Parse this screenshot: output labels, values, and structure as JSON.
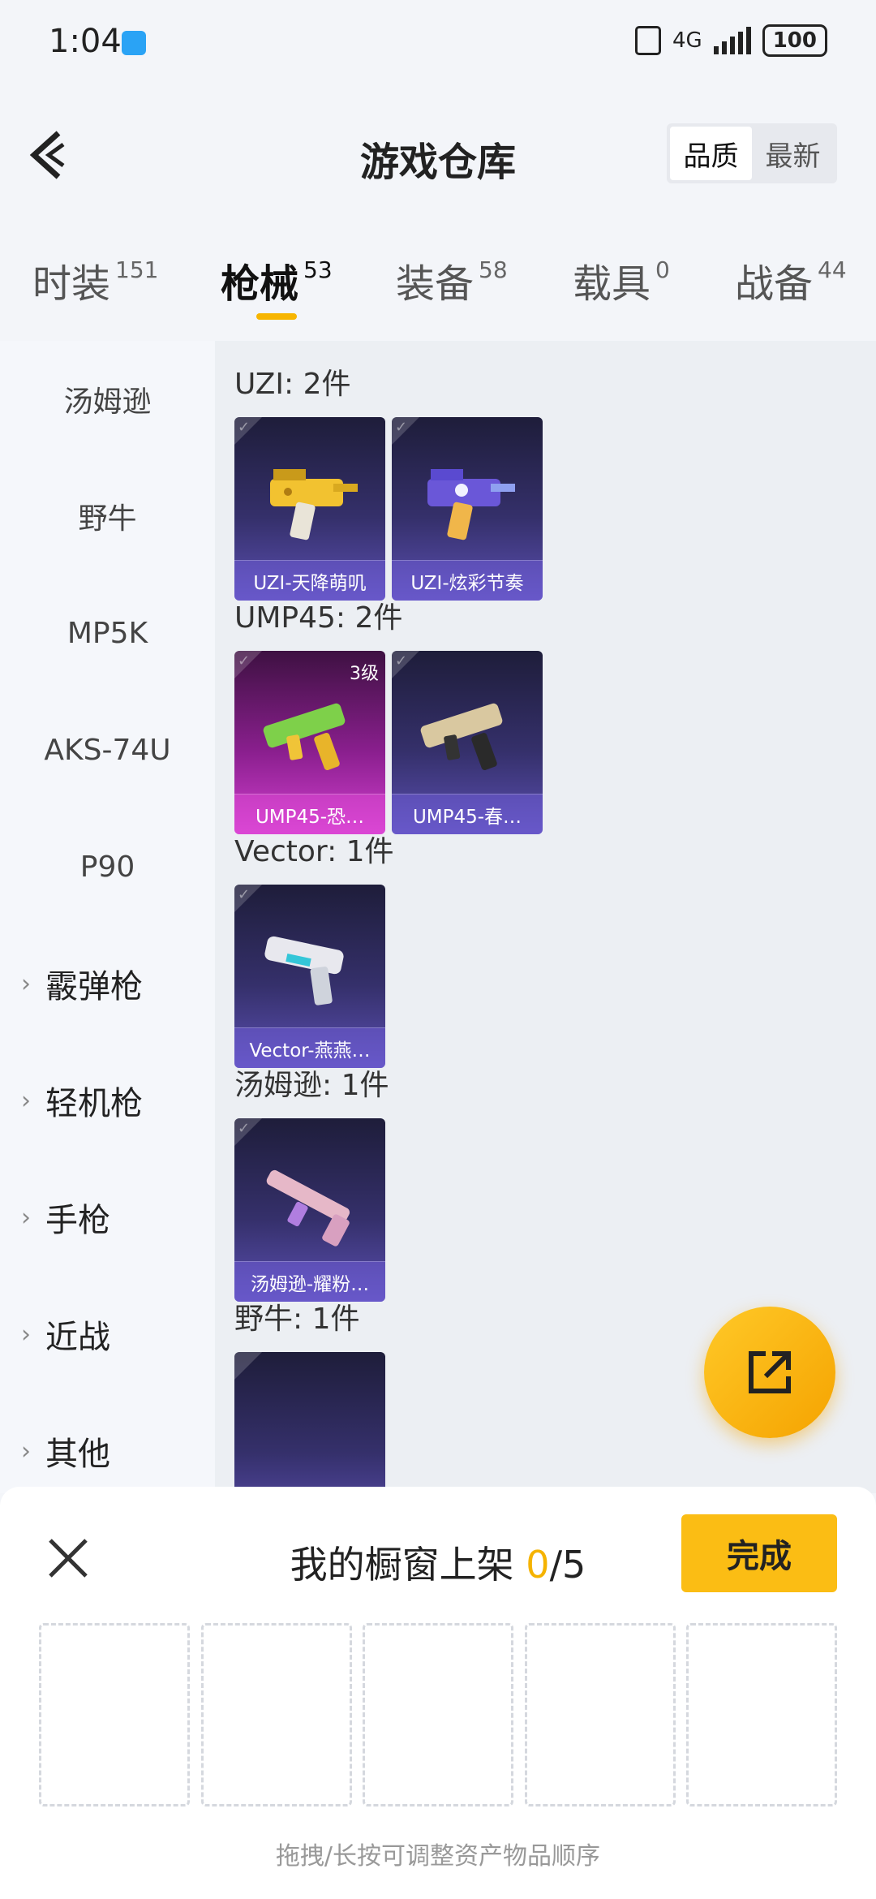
{
  "status_bar": {
    "time": "1:04",
    "network": "4G",
    "battery": "100"
  },
  "header": {
    "title": "游戏仓库",
    "sort_options": [
      "品质",
      "最新"
    ],
    "active_sort": "品质"
  },
  "tabs": [
    {
      "label": "时装",
      "count": "151"
    },
    {
      "label": "枪械",
      "count": "53"
    },
    {
      "label": "装备",
      "count": "58"
    },
    {
      "label": "载具",
      "count": "0"
    },
    {
      "label": "战备",
      "count": "44"
    }
  ],
  "active_tab": "枪械",
  "sidebar": {
    "items": [
      "汤姆逊",
      "野牛",
      "MP5K",
      "AKS-74U",
      "P90"
    ],
    "groups": [
      "霰弹枪",
      "轻机枪",
      "手枪",
      "近战",
      "其他"
    ]
  },
  "sections": [
    {
      "title": "UZI: 2件",
      "items": [
        {
          "name": "UZI-天降萌叽",
          "icon": "uzi-gold-icon"
        },
        {
          "name": "UZI-炫彩节奏",
          "icon": "uzi-purple-icon"
        }
      ]
    },
    {
      "title": "UMP45: 2件",
      "items": [
        {
          "name": "UMP45-恐…",
          "icon": "ump45-green-icon",
          "level": "3级"
        },
        {
          "name": "UMP45-春…",
          "icon": "ump45-gold-icon"
        }
      ]
    },
    {
      "title": "Vector: 1件",
      "items": [
        {
          "name": "Vector-燕燕…",
          "icon": "vector-white-icon"
        }
      ]
    },
    {
      "title": "汤姆逊: 1件",
      "items": [
        {
          "name": "汤姆逊-耀粉…",
          "icon": "thompson-pink-icon"
        }
      ]
    },
    {
      "title": "野牛: 1件",
      "items": []
    }
  ],
  "showcase": {
    "title_prefix": "我的橱窗上架",
    "count": "0",
    "total": "/5",
    "done_label": "完成",
    "hint": "拖拽/长按可调整资产物品顺序"
  },
  "colors": {
    "accent": "#f7b500",
    "card_purple": "#5b4fb2",
    "card_pink": "#d23fcf"
  }
}
